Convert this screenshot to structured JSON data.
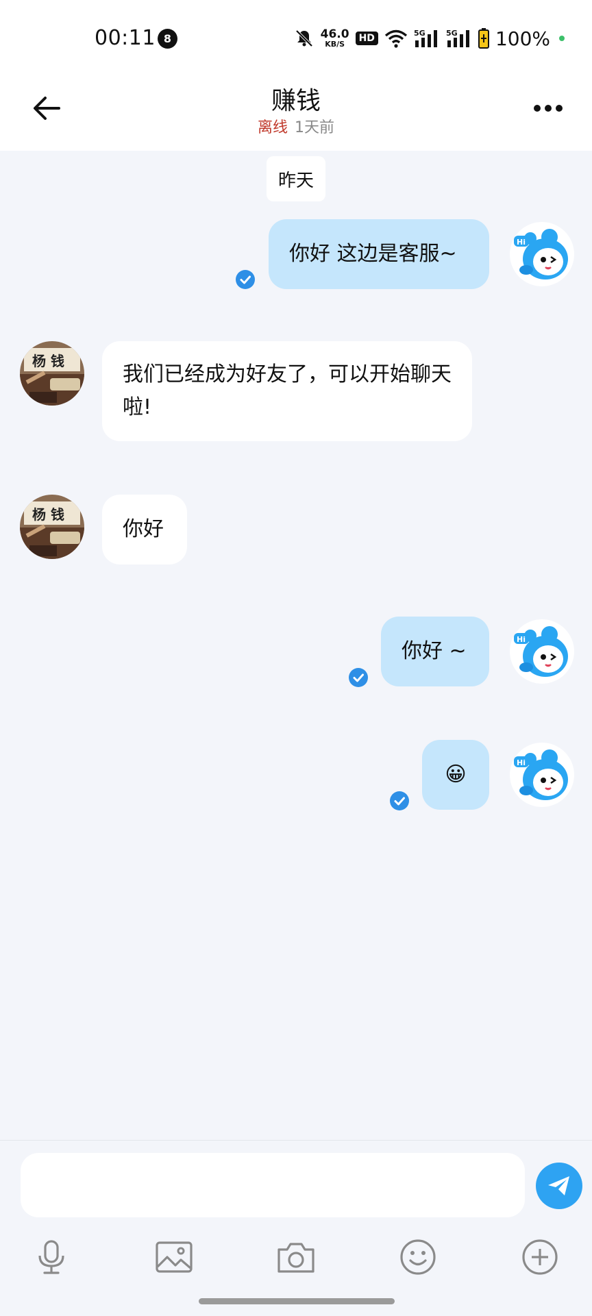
{
  "status_bar": {
    "time": "00:11",
    "notification_count": "8",
    "net_speed_value": "46.0",
    "net_speed_unit": "KB/S",
    "hd_label": "HD",
    "sim1_label": "5G",
    "sim2_label": "5G",
    "battery_percent": "100%"
  },
  "header": {
    "title": "赚钱",
    "status": "离线",
    "last_seen": "1天前"
  },
  "chat": {
    "date_separator": "昨天",
    "messages": [
      {
        "direction": "out",
        "text": "你好 这边是客服~",
        "read": true
      },
      {
        "direction": "in",
        "text": "我们已经成为好友了，可以开始聊天啦!"
      },
      {
        "direction": "in",
        "text": "你好"
      },
      {
        "direction": "out",
        "text": "你好 ~",
        "read": true
      },
      {
        "direction": "out",
        "text": "😀",
        "read": true
      }
    ],
    "contact_avatar_text": "杨 钱"
  },
  "input": {
    "placeholder": ""
  },
  "toolbar": [
    "microphone-icon",
    "image-icon",
    "camera-icon",
    "emoji-icon",
    "plus-icon"
  ],
  "colors": {
    "outgoing_bubble": "#c5e6fc",
    "incoming_bubble": "#ffffff",
    "background": "#f3f5fa",
    "accent": "#2ea3f2",
    "offline": "#c0392b"
  }
}
